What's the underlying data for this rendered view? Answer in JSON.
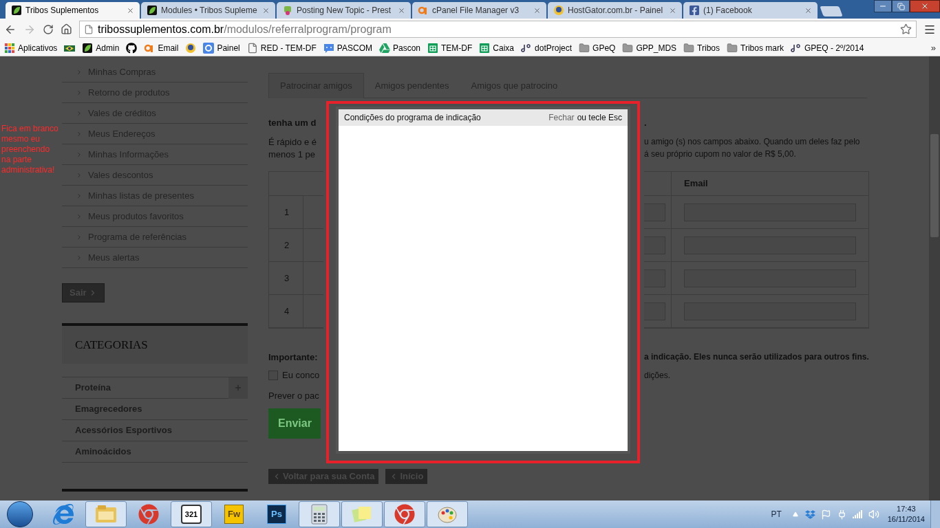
{
  "browser": {
    "tabs": [
      {
        "title": "Tribos Suplementos",
        "kind": "leaf",
        "selected": true
      },
      {
        "title": "Modules • Tribos Supleme",
        "kind": "leaf",
        "selected": false
      },
      {
        "title": "Posting New Topic - Prest",
        "kind": "shop",
        "selected": false
      },
      {
        "title": "cPanel File Manager v3",
        "kind": "cpanel",
        "selected": false
      },
      {
        "title": "HostGator.com.br - Painel",
        "kind": "gator",
        "selected": false
      },
      {
        "title": "(1) Facebook",
        "kind": "facebook",
        "selected": false
      }
    ],
    "address": {
      "host": "tribossuplementos.com.br",
      "path": "/modulos/referralprogram/program"
    },
    "bookmarks": [
      {
        "label": "Aplicativos",
        "kind": "apps"
      },
      {
        "kind": "bank"
      },
      {
        "label": "Admin",
        "kind": "leaf"
      },
      {
        "kind": "github"
      },
      {
        "label": "Email",
        "kind": "cpanel"
      },
      {
        "kind": "gator"
      },
      {
        "label": "Painel",
        "kind": "google"
      },
      {
        "label": "RED - TEM-DF",
        "kind": "page"
      },
      {
        "label": "PASCOM",
        "kind": "pascom"
      },
      {
        "label": "Pascon",
        "kind": "drive"
      },
      {
        "label": "TEM-DF",
        "kind": "sheets"
      },
      {
        "label": "Caixa",
        "kind": "sheets"
      },
      {
        "label": "dotProject",
        "kind": "dotproject"
      },
      {
        "label": "GPeQ",
        "kind": "folder"
      },
      {
        "label": "GPP_MDS",
        "kind": "folder"
      },
      {
        "label": "Tribos",
        "kind": "folder"
      },
      {
        "label": "Tribos  mark",
        "kind": "folder"
      },
      {
        "label": "GPEQ - 2º/2014",
        "kind": "dotproject"
      }
    ],
    "bookmarks_more": "»"
  },
  "annotation": {
    "note": "Fica em branco mesmo eu preenchendo na parte administrativa!"
  },
  "sidebar": {
    "account_links": [
      "Minhas Compras",
      "Retorno de produtos",
      "Vales de créditos",
      "Meus Endereços",
      "Minhas Informações",
      "Vales descontos",
      "Minhas listas de presentes",
      "Meus produtos favoritos",
      "Programa de referências",
      "Meus alertas"
    ],
    "logout_button": "Sair",
    "categories_title": "CATEGORIAS",
    "categories": [
      {
        "label": "Proteína",
        "expandable": true
      },
      {
        "label": "Emagrecedores",
        "expandable": false
      },
      {
        "label": "Acessórios Esportivos",
        "expandable": false
      },
      {
        "label": "Aminoácidos",
        "expandable": false
      }
    ]
  },
  "main": {
    "tabs": [
      {
        "label": "Patrocinar amigos",
        "selected": true
      },
      {
        "label": "Amigos pendentes",
        "selected": false
      },
      {
        "label": "Amigos que patrocino",
        "selected": false
      }
    ],
    "left_visible": {
      "heading": "tenha um d",
      "intro_lines": [
        "É rápido e é",
        "menos 1 pe"
      ],
      "row_numbers": [
        "1",
        "2",
        "3",
        "4"
      ],
      "important": "Importante:",
      "agree_text": "Eu conco",
      "agree_checked": false,
      "preview": "Prever o pac",
      "submit": "Enviar"
    },
    "right_visible": {
      "heading_end": ".",
      "intro_lines": [
        "u amigo (s) nos campos abaixo. Quando um deles faz pelo",
        "á seu próprio cupom no valor de R$ 5,00."
      ],
      "email_header": "Email",
      "important_end": "a indicação. Eles nunca serão utilizados para outros fins.",
      "agree_end": "dições."
    },
    "back_buttons": [
      "Voltar para sua Conta",
      "Início"
    ]
  },
  "modal": {
    "title": "Condições do programa de indicação",
    "close_link": "Fechar",
    "close_hint": "ou tecle Esc"
  },
  "taskbar": {
    "apps": [
      {
        "kind": "ie",
        "running": false
      },
      {
        "kind": "explorer",
        "running": true
      },
      {
        "kind": "chrome",
        "running": false
      },
      {
        "kind": "media",
        "label": "321",
        "running": true
      },
      {
        "kind": "fireworks",
        "label": "Fw",
        "running": false
      },
      {
        "kind": "photoshop",
        "label": "Ps",
        "running": false
      },
      {
        "kind": "calculator",
        "running": true
      },
      {
        "kind": "notes",
        "running": true
      },
      {
        "kind": "chrome",
        "running": true
      },
      {
        "kind": "paint",
        "running": true
      }
    ],
    "language": "PT",
    "time": "17:43",
    "date": "16/11/2014"
  }
}
